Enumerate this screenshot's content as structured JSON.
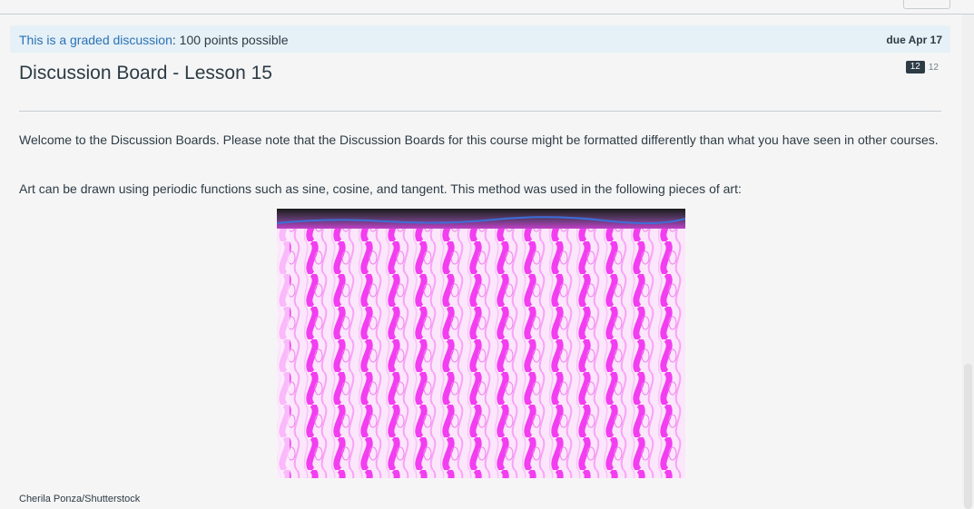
{
  "header": {
    "graded_link": "This is a graded discussion",
    "points": ": 100 points possible",
    "due": "due Apr 17"
  },
  "discussion": {
    "title": "Discussion Board - Lesson 15",
    "unread_count": "12",
    "total_count": "12"
  },
  "body": {
    "paragraph1": "Welcome to the Discussion Boards. Please note that the Discussion Boards for this course might be formatted differently than what you have seen in other courses.",
    "paragraph2": "Art can be drawn using periodic functions such as sine, cosine, and tangent. This method was used in the following pieces of art:",
    "image_credit": "Cherila Ponza/Shutterstock"
  },
  "colors": {
    "accent": "#2a72b5",
    "banner": "#e6f0f7",
    "art_magenta": "#f23ef0"
  }
}
